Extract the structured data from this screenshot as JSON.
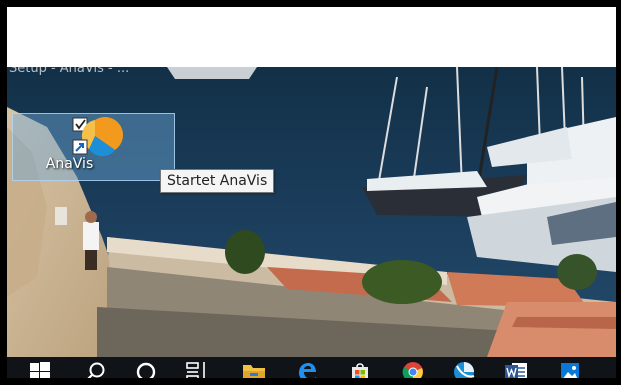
{
  "desktop": {
    "ghost_title": "Setup - AnaVis - ...",
    "icon": {
      "label": "AnaVis",
      "icon": "anavis-app-icon",
      "selected": true
    },
    "tooltip": "Startet AnaVis"
  },
  "taskbar": {
    "items": [
      {
        "name": "start",
        "icon": "windows-logo-icon"
      },
      {
        "name": "search",
        "icon": "search-icon"
      },
      {
        "name": "cortana",
        "icon": "cortana-circle-icon"
      },
      {
        "name": "task-view",
        "icon": "task-view-icon"
      },
      {
        "name": "file-explorer",
        "icon": "folder-icon"
      },
      {
        "name": "edge",
        "icon": "edge-icon"
      },
      {
        "name": "store",
        "icon": "store-bag-icon"
      },
      {
        "name": "chrome",
        "icon": "chrome-icon"
      },
      {
        "name": "anavis",
        "icon": "anavis-app-icon"
      },
      {
        "name": "word",
        "icon": "word-icon"
      },
      {
        "name": "photos",
        "icon": "photos-icon"
      }
    ]
  },
  "colors": {
    "taskbar": "#101318",
    "selection": "#6eaadc",
    "water": "#1a3550"
  }
}
